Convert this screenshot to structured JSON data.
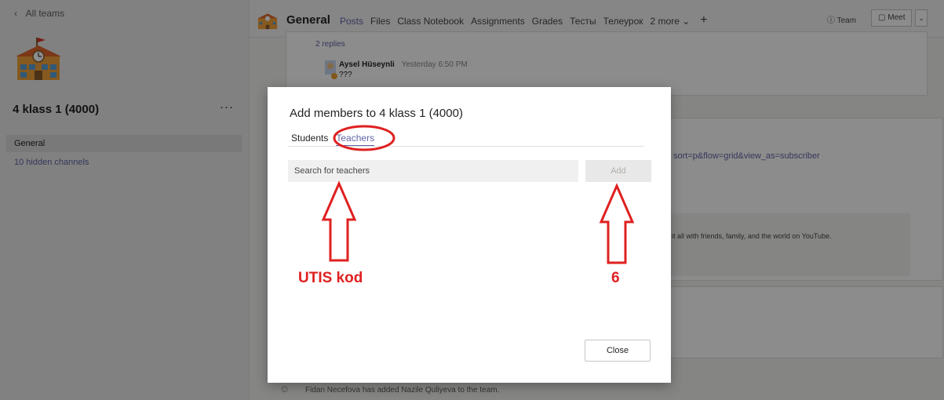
{
  "app": {
    "back_label": "All teams",
    "team_name": "4 klass 1 (4000)",
    "team_more": "···",
    "channels": {
      "general": "General",
      "hidden": "10 hidden channels"
    }
  },
  "header": {
    "channel_title": "General",
    "tabs": [
      "Posts",
      "Files",
      "Class Notebook",
      "Assignments",
      "Grades",
      "Тесты",
      "Телеурок",
      "2 more"
    ],
    "team_button": "Team",
    "meet_button": "Meet"
  },
  "feed": {
    "replies_count": "2 replies",
    "reply": {
      "author": "Aysel Hüseynli",
      "time": "Yesterday 6:50 PM",
      "text": "???"
    },
    "link_fragment": "sort=p&flow=grid&view_as=subscriber",
    "youtube_fragment": "it all with friends, family, and the world on YouTube.",
    "system_message": "Fidan Necefova has added Nazile Quliyeva to the team."
  },
  "dialog": {
    "title": "Add members to 4 klass 1 (4000)",
    "tabs": {
      "students": "Students",
      "teachers": "Teachers"
    },
    "search_placeholder": "Search for teachers",
    "add_label": "Add",
    "close_label": "Close"
  },
  "annotations": {
    "left_label": "UTIS kod",
    "right_label": "6",
    "color": "#e02020"
  },
  "colors": {
    "accent": "#6264a7"
  }
}
